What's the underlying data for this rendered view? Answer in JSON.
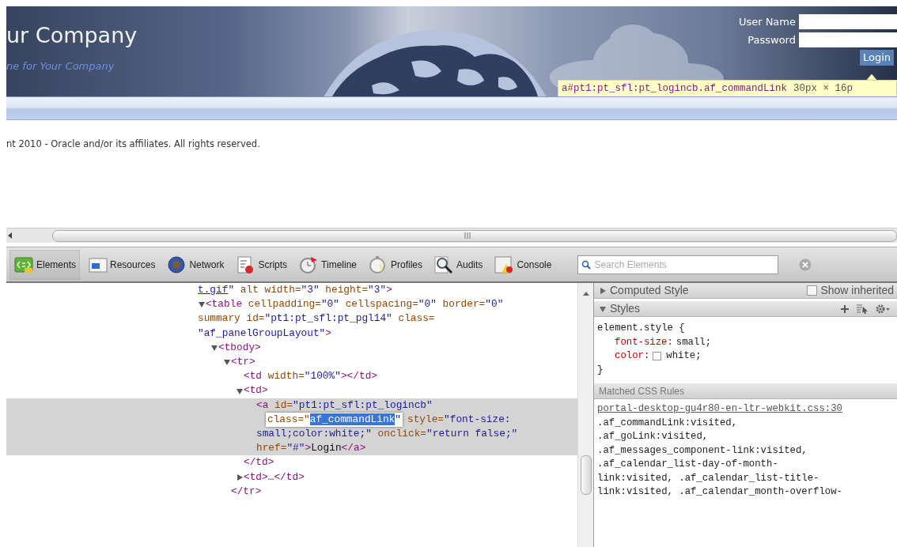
{
  "page": {
    "title": "ur Company",
    "tagline": "ne for Your Company",
    "login": {
      "fields": [
        {
          "label": "User Name"
        },
        {
          "label": "Password"
        }
      ],
      "link": "Login",
      "inspected": true
    },
    "tooltip": {
      "selector": "a#pt1:pt_sfl:pt_logincb.af_commandLink",
      "size": "30px × 16p"
    },
    "copyright": "nt 2010 - Oracle and/or its affiliates. All rights reserved."
  },
  "devtools": {
    "tabs": [
      {
        "label": "Elements",
        "selected": true
      },
      {
        "label": "Resources",
        "selected": false
      },
      {
        "label": "Network",
        "selected": false
      },
      {
        "label": "Scripts",
        "selected": false
      },
      {
        "label": "Timeline",
        "selected": false
      },
      {
        "label": "Profiles",
        "selected": false
      },
      {
        "label": "Audits",
        "selected": false
      },
      {
        "label": "Console",
        "selected": false
      }
    ],
    "search": {
      "placeholder": "Search Elements"
    },
    "dom_tree": [
      {
        "kind": "fragment",
        "link": "t.gif",
        "text": "\" alt width=\"3\" height=\"3\">",
        "selected": false
      },
      {
        "kind": "element",
        "lines": [
          "<table cellpadding=\"0\" cellspacing=\"0\" border=\"0\"",
          "summary id=\"pt1:pt_sfl:pt_pgl14\" class=",
          "\"af_panelGroupLayout\">"
        ],
        "expanded": true,
        "selected": false,
        "children": [
          {
            "kind": "element",
            "lines": [
              "<tbody>"
            ],
            "expanded": true,
            "selected": false,
            "children": [
              {
                "kind": "element",
                "lines": [
                  "<tr>"
                ],
                "expanded": true,
                "selected": false,
                "closing": "</tr>",
                "children": [
                  {
                    "kind": "element",
                    "lines": [
                      "<td width=\"100%\"></td>"
                    ],
                    "selected": false
                  },
                  {
                    "kind": "element",
                    "lines": [
                      "<td>"
                    ],
                    "expanded": true,
                    "selected": false,
                    "closing": "</td>",
                    "children": [
                      {
                        "kind": "editing",
                        "lines": [
                          "<a id=\"pt1:pt_sfl:pt_logincb\""
                        ],
                        "edit": {
                          "prefix": "class=\"",
                          "selected_text": "af_commandLink",
                          "suffix": "\""
                        },
                        "after": [
                          "style=\"font-size:",
                          "small;color:white;\" onclick=\"return false;\"",
                          "href=\"#\">Login</a>"
                        ],
                        "selected": true
                      }
                    ]
                  },
                  {
                    "kind": "element",
                    "lines": [
                      "<td>…</td>"
                    ],
                    "expanded": false,
                    "selected": false
                  }
                ]
              }
            ]
          }
        ]
      }
    ],
    "sidebar": {
      "computed": {
        "title": "Computed Style",
        "expanded": false,
        "show_inherited": {
          "label": "Show inherited",
          "checked": false
        }
      },
      "styles": {
        "title": "Styles",
        "expanded": true,
        "rule": {
          "selector": "element.style {",
          "properties": [
            {
              "name": "font-size:",
              "value": "small;"
            },
            {
              "name": "color:",
              "value": "white;",
              "color": "#ffffff"
            }
          ],
          "close": "}"
        }
      },
      "matched": {
        "title": "Matched CSS Rules",
        "source": "portal-desktop-gu4r80-en-ltr-webkit.css:30",
        "selector_lines": [
          ".af_commandLink:visited,",
          ".af_goLink:visited,",
          ".af_messages_component-link:visited,",
          ".af_calendar_list-day-of-month-",
          "link:visited, .af_calendar_list-title-",
          "link:visited, .af_calendar_month-overflow-"
        ]
      }
    }
  }
}
